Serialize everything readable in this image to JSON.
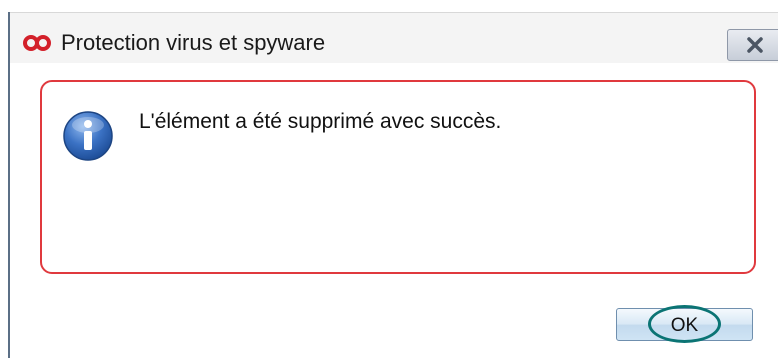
{
  "window": {
    "title": "Protection virus et spyware"
  },
  "dialog": {
    "message": "L'élément a été supprimé avec succès.",
    "ok_label": "OK"
  },
  "icons": {
    "title_logo": "mcafee-logo-icon",
    "close": "close-icon",
    "info": "info-icon"
  },
  "colors": {
    "panel_border": "#e0393e",
    "logo_red": "#d3202a",
    "info_blue": "#2e63b3",
    "highlight_ring": "#0b7474"
  }
}
